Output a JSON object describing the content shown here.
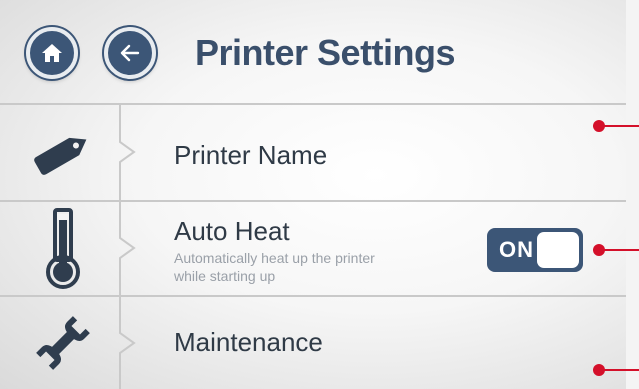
{
  "header": {
    "title": "Printer Settings",
    "home_icon": "home-icon",
    "back_icon": "arrow-left-icon"
  },
  "rows": [
    {
      "title": "Printer Name",
      "icon": "tag-icon"
    },
    {
      "title": "Auto Heat",
      "subtitle_line1": "Automatically heat up the printer",
      "subtitle_line2": "while starting up",
      "icon": "thermometer-icon",
      "toggle": "ON"
    },
    {
      "title": "Maintenance",
      "icon": "wrench-icon"
    }
  ],
  "colors": {
    "primary": "#3c5677",
    "title": "#3a4f6b",
    "callout": "#d4102a",
    "divider": "#c9c9c9"
  }
}
